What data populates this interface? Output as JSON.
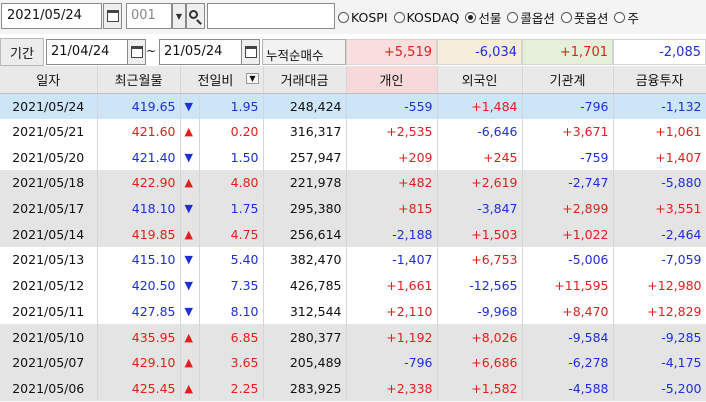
{
  "toolbar": {
    "date": "2021/05/24",
    "stock_code": "001",
    "stock_name": "",
    "markets": [
      {
        "label": "KOSPI",
        "selected": false
      },
      {
        "label": "KOSDAQ",
        "selected": false
      },
      {
        "label": "선물",
        "selected": true
      },
      {
        "label": "콜옵션",
        "selected": false
      },
      {
        "label": "풋옵션",
        "selected": false
      },
      {
        "label": "주",
        "selected": false
      }
    ]
  },
  "filter": {
    "period_label": "기간",
    "from_date": "21/04/24",
    "separator": "~",
    "to_date": "21/05/24",
    "cumulative_label": "누적순매수",
    "sums": [
      "+5,519",
      "-6,034",
      "+1,701",
      "-2,085"
    ]
  },
  "colors": {
    "up": "#e0201b",
    "down": "#1d2fd8",
    "selected_row": "#cce5f7",
    "gray_row": "#e4e4e4"
  },
  "table": {
    "headers": [
      "일자",
      "최근월물",
      "전일비",
      "거래대금",
      "개인",
      "외국인",
      "기관계",
      "금융투자"
    ],
    "rows": [
      {
        "date": "2021/05/24",
        "price": "419.65",
        "dir": "down",
        "change": "1.95",
        "amount": "248,424",
        "individual": "-559",
        "foreign": "+1,484",
        "institution": "-796",
        "financial": "-1,132",
        "style": "sel"
      },
      {
        "date": "2021/05/21",
        "price": "421.60",
        "dir": "up",
        "change": "0.20",
        "amount": "316,317",
        "individual": "+2,535",
        "foreign": "-6,646",
        "institution": "+3,671",
        "financial": "+1,061",
        "style": "white"
      },
      {
        "date": "2021/05/20",
        "price": "421.40",
        "dir": "down",
        "change": "1.50",
        "amount": "257,947",
        "individual": "+209",
        "foreign": "+245",
        "institution": "-759",
        "financial": "+1,407",
        "style": "white"
      },
      {
        "date": "2021/05/18",
        "price": "422.90",
        "dir": "up",
        "change": "4.80",
        "amount": "221,978",
        "individual": "+482",
        "foreign": "+2,619",
        "institution": "-2,747",
        "financial": "-5,880",
        "style": "gray"
      },
      {
        "date": "2021/05/17",
        "price": "418.10",
        "dir": "down",
        "change": "1.75",
        "amount": "295,380",
        "individual": "+815",
        "foreign": "-3,847",
        "institution": "+2,899",
        "financial": "+3,551",
        "style": "gray"
      },
      {
        "date": "2021/05/14",
        "price": "419.85",
        "dir": "up",
        "change": "4.75",
        "amount": "256,614",
        "individual": "-2,188",
        "foreign": "+1,503",
        "institution": "+1,022",
        "financial": "-2,464",
        "style": "gray"
      },
      {
        "date": "2021/05/13",
        "price": "415.10",
        "dir": "down",
        "change": "5.40",
        "amount": "382,470",
        "individual": "-1,407",
        "foreign": "+6,753",
        "institution": "-5,006",
        "financial": "-7,059",
        "style": "white"
      },
      {
        "date": "2021/05/12",
        "price": "420.50",
        "dir": "down",
        "change": "7.35",
        "amount": "426,785",
        "individual": "+1,661",
        "foreign": "-12,565",
        "institution": "+11,595",
        "financial": "+12,980",
        "style": "white"
      },
      {
        "date": "2021/05/11",
        "price": "427.85",
        "dir": "down",
        "change": "8.10",
        "amount": "312,544",
        "individual": "+2,110",
        "foreign": "-9,968",
        "institution": "+8,470",
        "financial": "+12,829",
        "style": "white"
      },
      {
        "date": "2021/05/10",
        "price": "435.95",
        "dir": "up",
        "change": "6.85",
        "amount": "280,377",
        "individual": "+1,192",
        "foreign": "+8,026",
        "institution": "-9,584",
        "financial": "-9,285",
        "style": "gray"
      },
      {
        "date": "2021/05/07",
        "price": "429.10",
        "dir": "up",
        "change": "3.65",
        "amount": "205,489",
        "individual": "-796",
        "foreign": "+6,686",
        "institution": "-6,278",
        "financial": "-4,175",
        "style": "gray"
      },
      {
        "date": "2021/05/06",
        "price": "425.45",
        "dir": "up",
        "change": "2.25",
        "amount": "283,925",
        "individual": "+2,338",
        "foreign": "+1,582",
        "institution": "-4,588",
        "financial": "-5,200",
        "style": "gray"
      }
    ]
  }
}
